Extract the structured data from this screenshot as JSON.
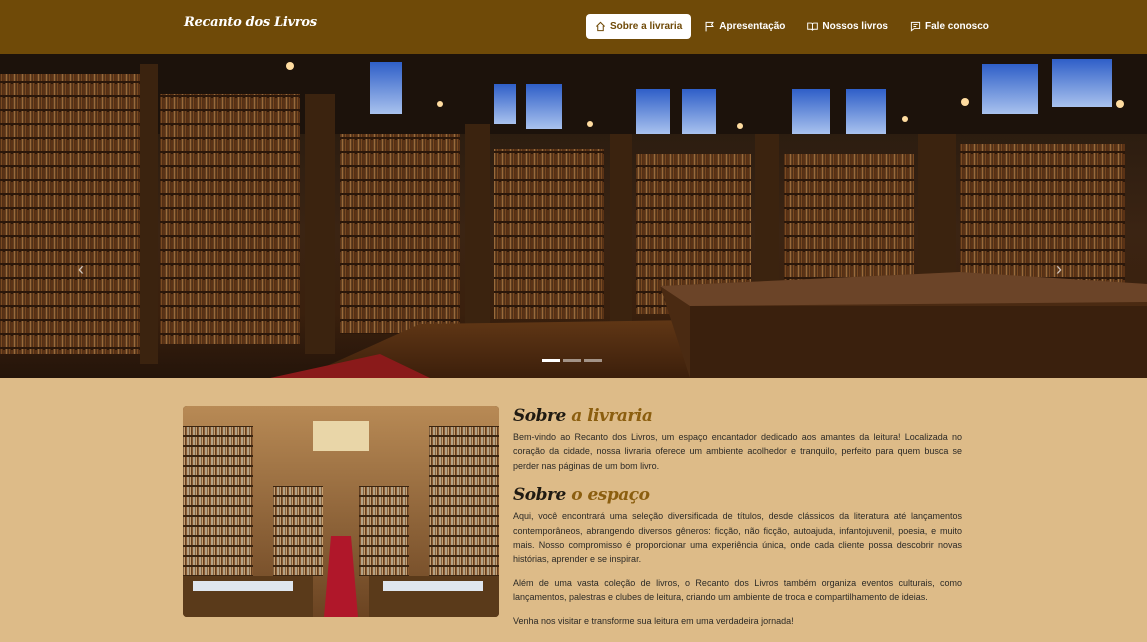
{
  "brand": "Recanto dos Livros",
  "nav": {
    "items": [
      {
        "label": "Sobre a livraria",
        "icon": "home-icon",
        "active": true
      },
      {
        "label": "Apresentação",
        "icon": "flag-icon",
        "active": false
      },
      {
        "label": "Nossos livros",
        "icon": "book-icon",
        "active": false
      },
      {
        "label": "Fale conosco",
        "icon": "chat-icon",
        "active": false
      }
    ]
  },
  "hero": {
    "prev_arrow": "‹",
    "next_arrow": "›",
    "slides": 3,
    "active_slide": 1
  },
  "about": {
    "title_main": "Sobre",
    "title_accent": "a livraria",
    "paragraph": "Bem-vindo ao Recanto dos Livros, um espaço encantador dedicado aos amantes da leitura! Localizada no coração da cidade, nossa livraria oferece um ambiente acolhedor e tranquilo, perfeito para quem busca se perder nas páginas de um bom livro."
  },
  "space": {
    "title_main": "Sobre",
    "title_accent": "o espaço",
    "paragraph1": "Aqui, você encontrará uma seleção diversificada de títulos, desde clássicos da literatura até lançamentos contemporâneos, abrangendo diversos gêneros: ficção, não ficção, autoajuda, infantojuvenil, poesia, e muito mais. Nosso compromisso é proporcionar uma experiência única, onde cada cliente possa descobrir novas histórias, aprender e se inspirar.",
    "paragraph2": "Além de uma vasta coleção de livros, o Recanto dos Livros também organiza eventos culturais, como lançamentos, palestras e clubes de leitura, criando um ambiente de troca e compartilhamento de ideias.",
    "paragraph3": "Venha nos visitar e transforme sua leitura em uma verdadeira jornada!"
  },
  "colors": {
    "navbar": "#6F4A08",
    "page_bg": "#DDBB88",
    "accent": "#8B5E0F"
  }
}
